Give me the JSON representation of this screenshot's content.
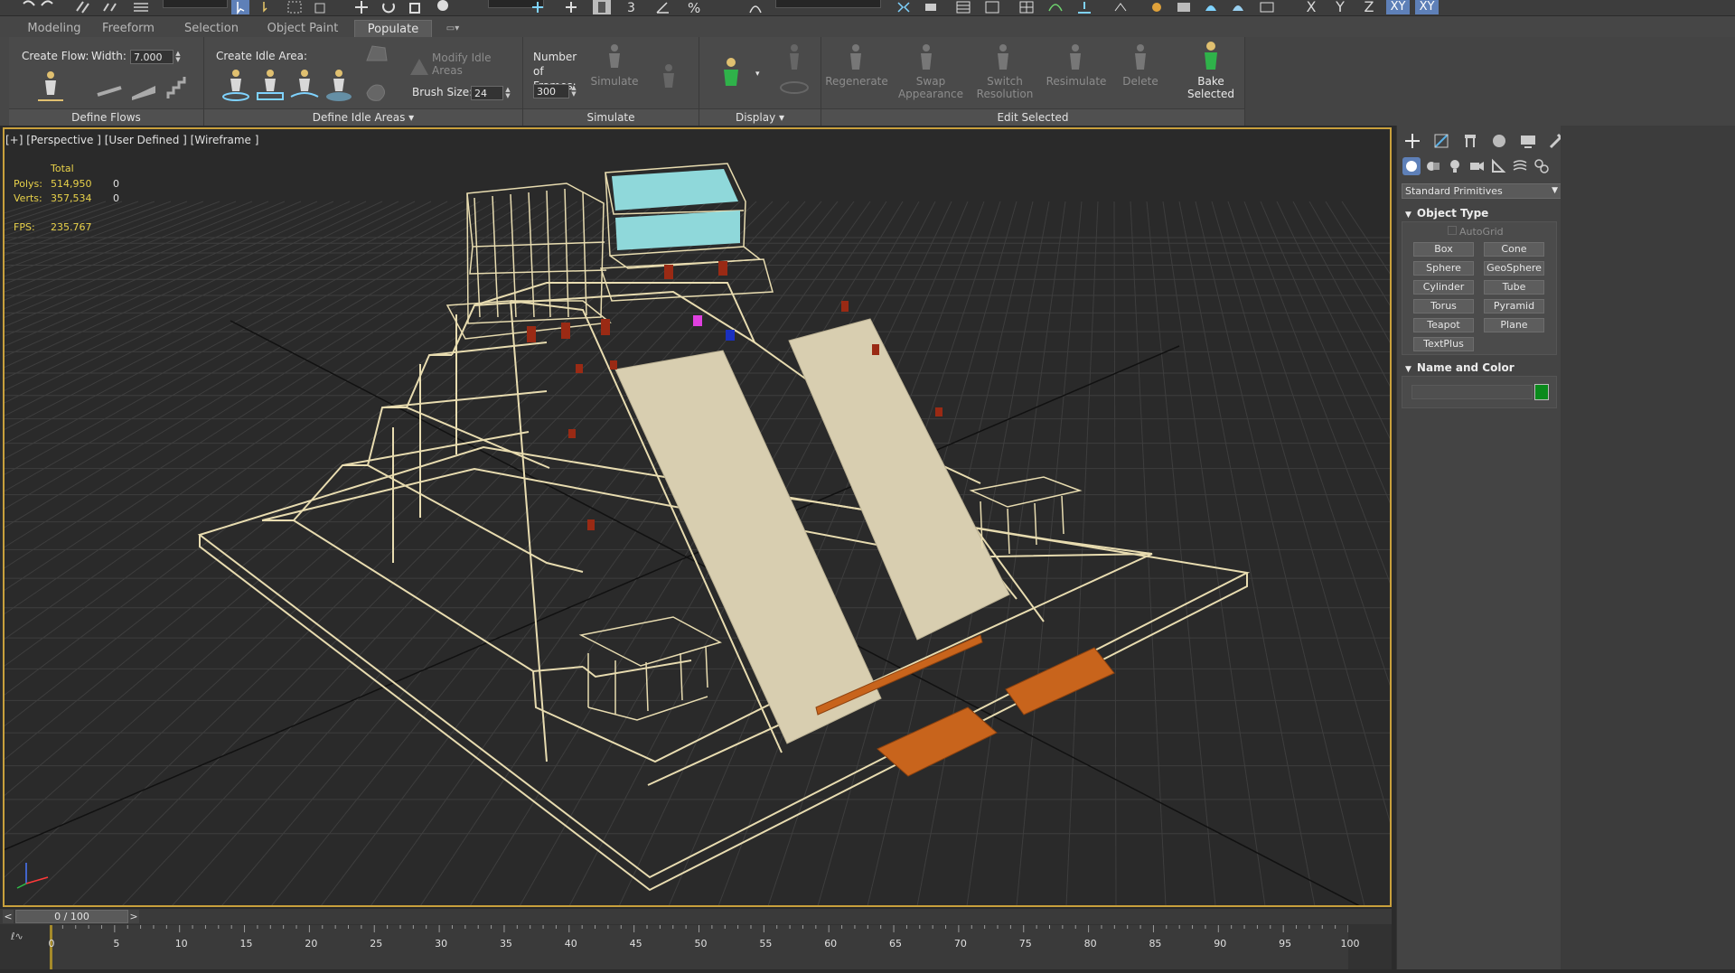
{
  "ribbon_tabs": [
    {
      "label": "Modeling"
    },
    {
      "label": "Freeform"
    },
    {
      "label": "Selection"
    },
    {
      "label": "Object Paint"
    },
    {
      "label": "Populate"
    }
  ],
  "ribbon_tab_active": "Populate",
  "ribbon": {
    "create_flow_label": "Create Flow:",
    "width_label": "Width:",
    "width_value": "7.000",
    "create_idle_label": "Create Idle Area:",
    "modify_idle_label": "Modify Idle Areas",
    "brush_size_label": "Brush Size:",
    "brush_size_value": "24",
    "number_frames_label": "Number of Frames:",
    "number_frames_value": "300",
    "simulate_label": "Simulate",
    "regenerate_label": "Regenerate",
    "swap_appearance_label": "Swap Appearance",
    "switch_resolution_label": "Switch Resolution",
    "resimulate_label": "Resimulate",
    "delete_label": "Delete",
    "bake_selected_label": "Bake Selected",
    "panels": {
      "define_flows": "Define Flows",
      "define_idle_areas": "Define Idle Areas",
      "simulate": "Simulate",
      "display": "Display",
      "edit_selected": "Edit Selected"
    }
  },
  "axis_buttons": [
    "X",
    "Y",
    "Z",
    "XY",
    "XY"
  ],
  "viewport": {
    "label": "[+] [Perspective ] [User Defined ] [Wireframe ]",
    "stats": {
      "total_label": "Total",
      "polys_label": "Polys:",
      "polys_value": "514,950",
      "polys_sel": "0",
      "verts_label": "Verts:",
      "verts_value": "357,534",
      "verts_sel": "0",
      "fps_label": "FPS:",
      "fps_value": "235.767"
    }
  },
  "command_panel": {
    "dropdown": "Standard Primitives",
    "object_type_title": "Object Type",
    "autogrid_label": "AutoGrid",
    "primitives": [
      "Box",
      "Cone",
      "Sphere",
      "GeoSphere",
      "Cylinder",
      "Tube",
      "Torus",
      "Pyramid",
      "Teapot",
      "Plane",
      "TextPlus"
    ],
    "name_color_title": "Name and Color",
    "name_value": "",
    "color": "#0a8a1c"
  },
  "timeline": {
    "slider_label": "0 / 100",
    "prev_label": "<",
    "next_label": ">",
    "ticks": [
      "0",
      "5",
      "10",
      "15",
      "20",
      "25",
      "30",
      "35",
      "40",
      "45",
      "50",
      "55",
      "60",
      "65",
      "70",
      "75",
      "80",
      "85",
      "90",
      "95",
      "100"
    ]
  },
  "colors": {
    "wire": "#e8dcb0",
    "stairs": "#d8ceb0",
    "roof_glass": "#8fd8da",
    "accent_red": "#9a2a14",
    "orange": "#c8641c",
    "viewport_border": "#c8a03c",
    "active_blue": "#5e80b8"
  }
}
